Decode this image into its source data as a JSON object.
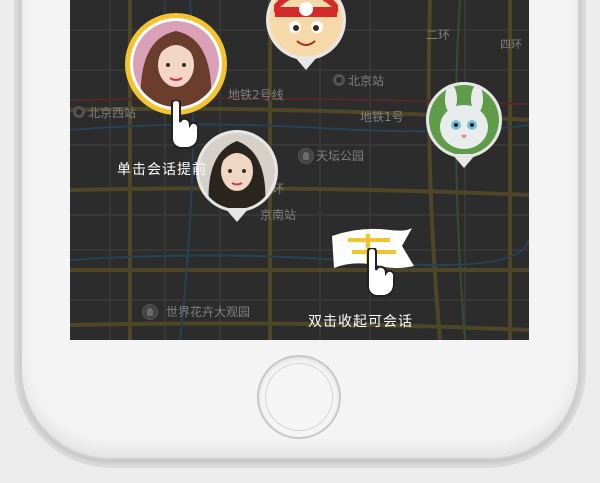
{
  "map": {
    "labels": {
      "beijing_west": "北京西站",
      "beijing_station": "北京站",
      "line2": "地铁2号线",
      "line1": "地铁1号",
      "temple_park": "天坛公园",
      "south_station": "京南站",
      "expo_park": "世界花卉大观园",
      "second_ring_top": "二环",
      "second_ring_mid": "二环",
      "third_ring": "四环"
    }
  },
  "hints": {
    "tap_hint": "单击会话提前",
    "double_tap_hint": "双击收起可会话"
  },
  "colors": {
    "ring_active": "#f4c430",
    "screen_bg": "#3a3a3a",
    "road_yellow": "#7a6a2a",
    "road_light": "#555555"
  },
  "icons": [
    "hand-pointer-icon",
    "flag-icon",
    "avatar-icon",
    "subway-icon",
    "poi-icon"
  ]
}
